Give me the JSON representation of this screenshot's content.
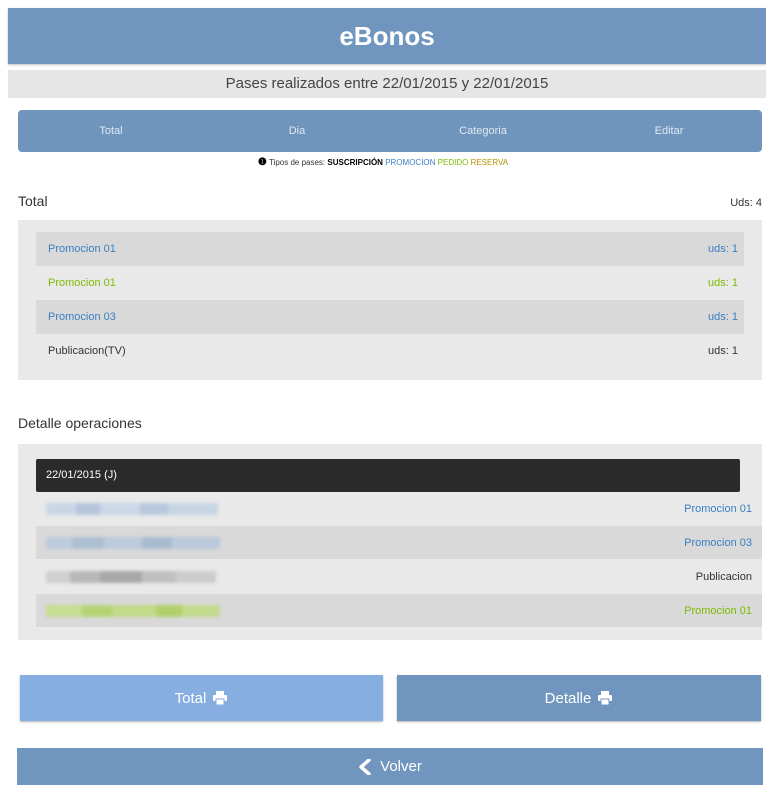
{
  "header": {
    "title": "eBonos"
  },
  "subheader": {
    "text": "Pases realizados entre 22/01/2015 y 22/01/2015"
  },
  "tabs": [
    {
      "label": "Total"
    },
    {
      "label": "Dia"
    },
    {
      "label": "Categoria"
    },
    {
      "label": "Editar"
    }
  ],
  "legend": {
    "icon": "info-icon",
    "label": "Tipos de pases:",
    "types": [
      "SUSCRIPCIÓN",
      "PROMOCION",
      "PEDIDO",
      "RESERVA"
    ]
  },
  "total": {
    "title": "Total",
    "count": "Uds: 4",
    "rows": [
      {
        "name": "Promocion 01",
        "qty": "uds: 1"
      },
      {
        "name": "Promocion 01",
        "qty": "uds: 1"
      },
      {
        "name": "Promocion 03",
        "qty": "uds: 1"
      },
      {
        "name": "Publicacion(TV)",
        "qty": "uds: 1"
      }
    ]
  },
  "detail": {
    "title": "Detalle operaciones",
    "date": "22/01/2015 (J)",
    "ops": [
      {
        "type": "Promocion 01"
      },
      {
        "type": "Promocion 03"
      },
      {
        "type": "Publicacion"
      },
      {
        "type": "Promocion 01"
      }
    ]
  },
  "buttons": {
    "total": "Total",
    "detalle": "Detalle",
    "volver": "Volver",
    "print_icon": "printer-icon",
    "back_icon": "chevron-left-icon"
  },
  "colors": {
    "header": "#7096bf",
    "promocion": "#3b7fc4",
    "pedido": "#7cbb00",
    "reserva": "#b49200"
  }
}
